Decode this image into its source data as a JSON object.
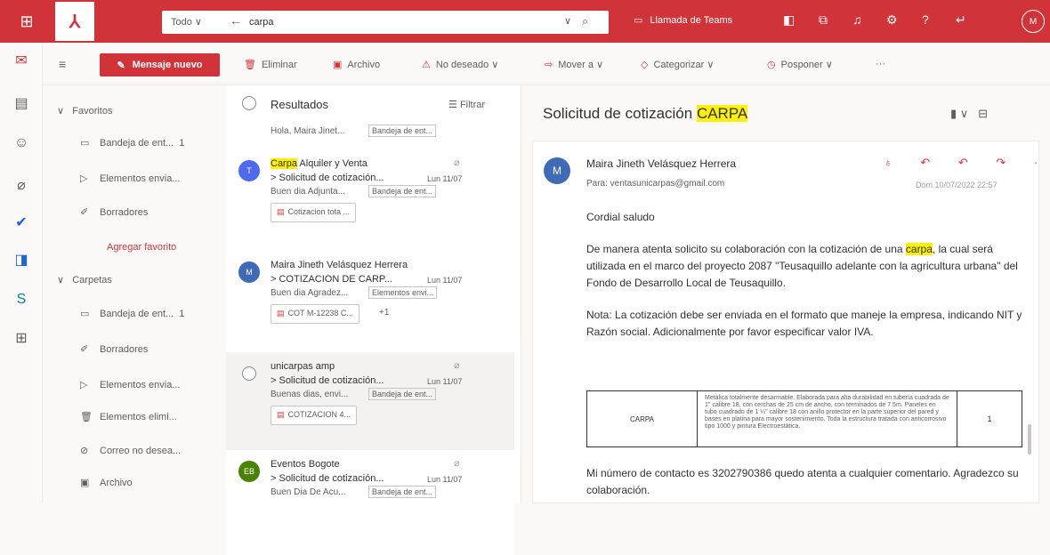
{
  "topbar": {
    "color": "#d13438",
    "search_scope": "Todo",
    "search_query": "carpa",
    "teams_call": "Llamada de Teams",
    "avatar_initial": "M"
  },
  "command_bar": {
    "new_message": "Mensaje nuevo",
    "delete": "Eliminar",
    "archive": "Archivo",
    "junk": "No deseado",
    "move": "Mover a",
    "categorize": "Categorizar",
    "snooze": "Posponer",
    "more": "···"
  },
  "folders": {
    "favorites_label": "Favoritos",
    "favorites": [
      {
        "label": "Bandeja de ent...",
        "count": "1",
        "icon": "inbox-icon"
      },
      {
        "label": "Elementos envia...",
        "count": "",
        "icon": "send-icon"
      },
      {
        "label": "Borradores",
        "count": "",
        "icon": "drafts-icon"
      }
    ],
    "add_favorite": "Agregar favorito",
    "folders_label": "Carpetas",
    "folders": [
      {
        "label": "Bandeja de ent...",
        "count": "1",
        "icon": "inbox-icon"
      },
      {
        "label": "Borradores",
        "count": "",
        "icon": "drafts-icon"
      },
      {
        "label": "Elementos envia...",
        "count": "",
        "icon": "send-icon"
      },
      {
        "label": "Elementos elimi...",
        "count": "",
        "icon": "trash-icon"
      },
      {
        "label": "Correo no desea...",
        "count": "",
        "icon": "junk-icon"
      },
      {
        "label": "Archivo",
        "count": "",
        "icon": "archive-icon"
      }
    ]
  },
  "list": {
    "title": "Resultados",
    "filter": "Filtrar",
    "partial_preview": "Hola, Maira Jinet...",
    "partial_tag": "Bandeja de ent...",
    "messages": [
      {
        "avatar": "T",
        "avatar_color": "#4f6bed",
        "sender_hl": "Carpa",
        "sender_rest": " Alquiler y Venta",
        "subject": "> Solicitud de cotización...",
        "date": "Lun 11/07",
        "preview": "Buen dia Adjunta...",
        "tag": "Bandeja de ent...",
        "attachment": "Cotizacion tota ...",
        "more": ""
      },
      {
        "avatar": "M",
        "avatar_color": "#3f6ab5",
        "sender_hl": "",
        "sender_rest": "Maira Jineth Velásquez Herrera",
        "subject": "> COTIZACIÓN DE CARP...",
        "date": "Lun 11/07",
        "preview": "Buen dia Agradez...",
        "tag": "Elementos envi...",
        "attachment": "COT M-12238 C...",
        "more": "+1"
      },
      {
        "avatar": "",
        "avatar_color": "#ffffff",
        "sender_hl": "",
        "sender_rest": "unicarpas amp",
        "subject": "> Solicitud de cotización...",
        "date": "Lun 11/07",
        "preview": "Buenas dias, envi...",
        "tag": "Bandeja de ent...",
        "attachment": "COTIZACION 4...",
        "more": ""
      },
      {
        "avatar": "EB",
        "avatar_color": "#498205",
        "sender_hl": "",
        "sender_rest": "Eventos Bogote",
        "subject": "> Solicitud de cotización...",
        "date": "Lun 11/07",
        "preview": "Buen Dia De Acu...",
        "tag": "Bandeja de ent...",
        "attachment": "",
        "more": ""
      }
    ]
  },
  "reading": {
    "title_prefix": "Solicitud de cotización ",
    "title_hl": "CARPA",
    "sender": "Maira Jineth Velásquez Herrera",
    "to": "Para: ventasunicarpas@gmail.com",
    "date": "Dom 10/07/2022 22:57",
    "actions": "♁ ↶ ↶ ↷ ···",
    "greeting": "Cordial saludo",
    "p1_a": "De manera atenta solicito su colaboración con la cotización de una ",
    "p1_hl": "carpa",
    "p1_b": ", la cual será utilizada en el marco del proyecto 2087 \"Teusaquillo adelante con la agricultura urbana\" del Fondo de Desarrollo Local de Teusaquillo.",
    "p2": "Nota: La cotización debe ser enviada en el formato que maneje la empresa, indicando NIT y Razón social. Adicionalmente por favor especificar valor IVA.",
    "table_item": "CARPA",
    "table_desc": "Metálica totalmente desarmable. Elaborada para alta durabilidad en tubería cuadrada de 1\" calibre 18, con cerchas de 25 cm de ancho, con terminados de 7.5m. Paneles en tubo cuadrado de 1 ¼\" calibre 18 con anillo protector en la parte superior del pared y bases en platina para mayor sostenimiento. Toda la estructura tratada con anticorrosivo tipo 1000 y pintura Electroestática.",
    "table_qty": "1",
    "p3": "Mi número de contacto es 3202790386 quedo atenta a cualquier comentario. Agradezco su colaboración."
  }
}
